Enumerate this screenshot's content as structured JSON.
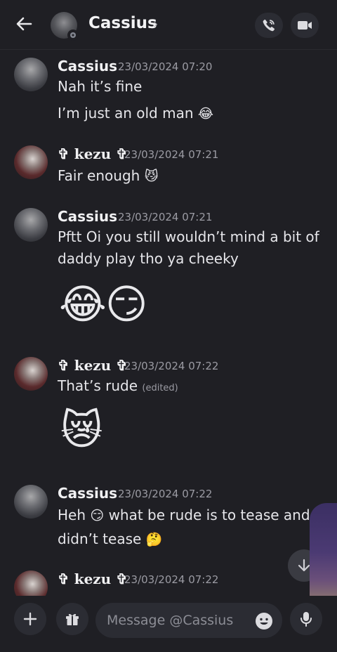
{
  "header": {
    "back_icon": "arrow-left-icon",
    "title": "Cassius",
    "chevron": "›",
    "status": "offline"
  },
  "messages": [
    {
      "author": "Cassius",
      "time": "23/03/2024 07:20",
      "lines": [
        "Nah it’s fine",
        "I’m just an old man"
      ],
      "emoji": "😂"
    },
    {
      "author": "✞ kezu ✞",
      "time": "23/03/2024 07:21",
      "lines": [
        "Fair enough"
      ],
      "emoji": "😼"
    },
    {
      "author": "Cassius",
      "time": "23/03/2024 07:21",
      "lines": [
        "Pftt Oi you still wouldn’t mind a bit of",
        "daddy play tho ya cheeky"
      ],
      "emojis_large": [
        "😂",
        "😏"
      ]
    },
    {
      "author": "✞ kezu ✞",
      "time": "23/03/2024 07:22",
      "lines": [
        "That’s rude"
      ],
      "edited": "(edited)",
      "emojis_large": [
        "😿"
      ]
    },
    {
      "author": "Cassius",
      "time": "23/03/2024 07:22",
      "line1_before": "Heh",
      "line1_emoji": "😏",
      "line1_after": "what be rude is to tease and I",
      "line2": "didn’t tease",
      "line2_emoji": "🤔"
    },
    {
      "author": "✞ kezu ✞",
      "time": "23/03/2024 07:22"
    }
  ],
  "composer": {
    "placeholder": "Message @Cassius"
  },
  "colors": {
    "background": "#1f1f24",
    "button_bg": "#2b2c33",
    "timestamp": "#9b9ba3"
  }
}
